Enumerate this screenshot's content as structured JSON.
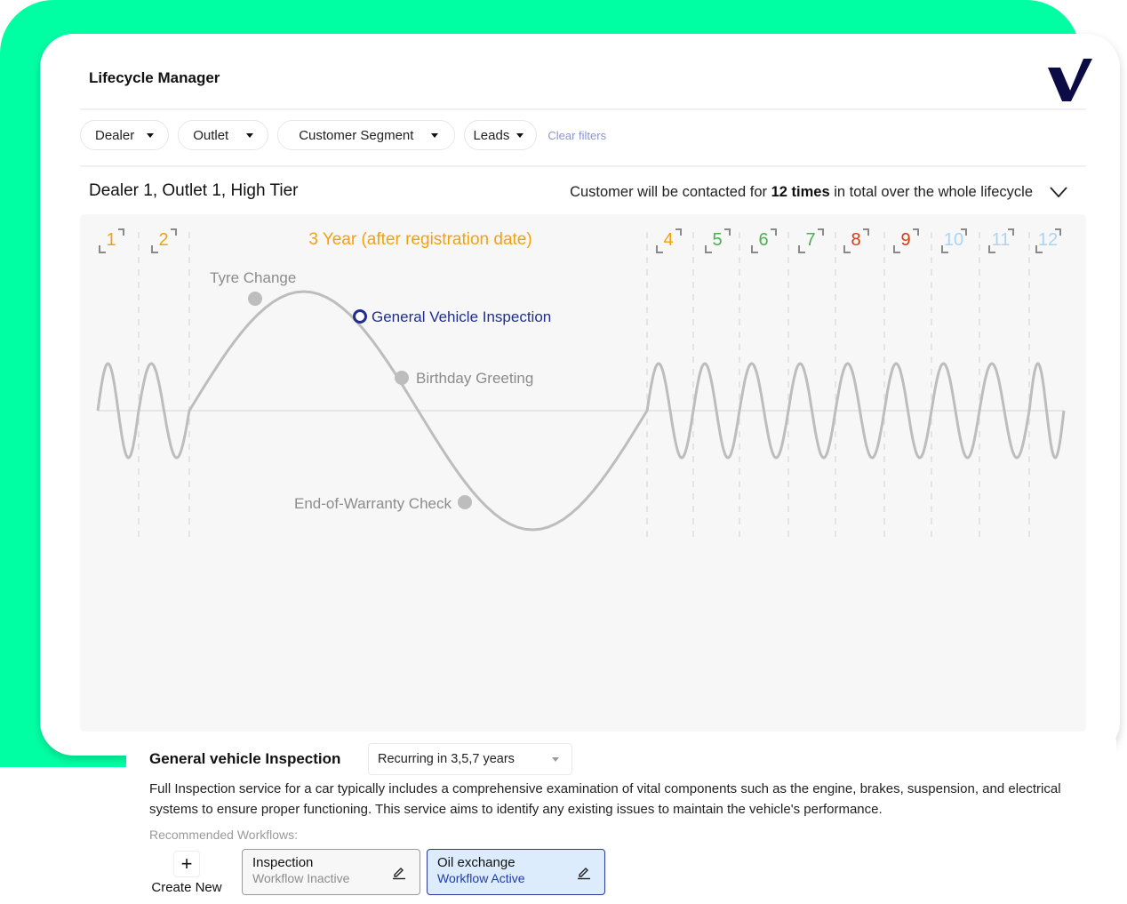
{
  "app": {
    "title": "Lifecycle Manager",
    "logo": "brand-check-logo"
  },
  "filters": {
    "items": [
      {
        "label": "Dealer",
        "icon": "caret-down-icon"
      },
      {
        "label": "Outlet",
        "icon": "caret-down-icon"
      },
      {
        "label": "Customer Segment",
        "icon": "caret-down-icon"
      },
      {
        "label": "Leads",
        "icon": "caret-down-icon"
      }
    ],
    "clear_label": "Clear filters"
  },
  "segment": {
    "title": "Dealer 1, Outlet 1, High Tier",
    "contact_prefix": "Customer will be contacted  for ",
    "contact_count": "12 times",
    "contact_suffix": " in total over the whole lifecycle",
    "collapse_icon": "chevron-down-icon"
  },
  "timeline": {
    "highlight_label": "3 Year (after registration date)",
    "highlight_color": "#f5a00f",
    "markers": [
      {
        "label": "1",
        "color": "#f5a00f"
      },
      {
        "label": "2",
        "color": "#f5a00f"
      },
      {
        "label": "3",
        "color": "#f5a00f"
      },
      {
        "label": "4",
        "color": "#f5a00f"
      },
      {
        "label": "5",
        "color": "#4caf50"
      },
      {
        "label": "6",
        "color": "#4caf50"
      },
      {
        "label": "7",
        "color": "#4caf50"
      },
      {
        "label": "8",
        "color": "#d63a0f"
      },
      {
        "label": "9",
        "color": "#d63a0f"
      },
      {
        "label": "10",
        "color": "#a8d4fa"
      },
      {
        "label": "11",
        "color": "#a8d4fa"
      },
      {
        "label": "12",
        "color": "#a8d4fa"
      }
    ],
    "events": [
      {
        "label": "Tyre Change",
        "selected": false
      },
      {
        "label": "General Vehicle Inspection",
        "selected": true
      },
      {
        "label": "Birthday Greeting",
        "selected": false
      },
      {
        "label": "End-of-Warranty Check",
        "selected": false
      }
    ],
    "selected_color": "#1f2e8f",
    "curve_color": "#bdbdbd"
  },
  "detail": {
    "title": "General vehicle Inspection",
    "recurrence": "Recurring in 3,5,7 years",
    "description": "Full Inspection service for a car typically includes a comprehensive examination of vital components such as the engine, brakes, suspension, and electrical systems to ensure proper functioning. This service aims to identify any existing issues to maintain the vehicle's performance.",
    "recommended_label": "Recommended Workflows:",
    "create_new_label": "Create New",
    "workflows": [
      {
        "name": "Inspection",
        "status": "Workflow Inactive",
        "active": false
      },
      {
        "name": "Oil exchange",
        "status": "Workflow Active",
        "active": true
      }
    ]
  }
}
